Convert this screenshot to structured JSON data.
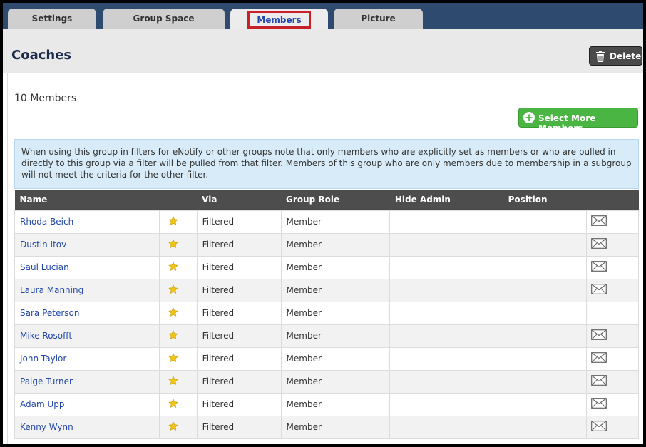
{
  "tabs": [
    {
      "label": "Settings"
    },
    {
      "label": "Group Space"
    },
    {
      "label": "Members"
    },
    {
      "label": "Picture"
    }
  ],
  "header": {
    "title": "Coaches",
    "delete_label": "Delete"
  },
  "members_count": "10 Members",
  "select_more_label": "Select More Members",
  "notice": "When using this group in filters for eNotify or other groups note that only members who are explicitly set as members or who are pulled in directly to this group via a filter will be pulled from that filter. Members of this group who are only members due to membership in a subgroup will not meet the criteria for the other filter.",
  "table": {
    "headers": [
      "Name",
      "",
      "Via",
      "Group Role",
      "Hide Admin",
      "Position",
      ""
    ],
    "rows": [
      {
        "name": "Rhoda Beich",
        "via": "Filtered",
        "role": "Member",
        "mail": true
      },
      {
        "name": "Dustin Itov",
        "via": "Filtered",
        "role": "Member",
        "mail": true
      },
      {
        "name": "Saul Lucian",
        "via": "Filtered",
        "role": "Member",
        "mail": true
      },
      {
        "name": "Laura Manning",
        "via": "Filtered",
        "role": "Member",
        "mail": true
      },
      {
        "name": "Sara Peterson",
        "via": "Filtered",
        "role": "Member",
        "mail": false
      },
      {
        "name": "Mike Rosofft",
        "via": "Filtered",
        "role": "Member",
        "mail": true
      },
      {
        "name": "John Taylor",
        "via": "Filtered",
        "role": "Member",
        "mail": true
      },
      {
        "name": "Paige Turner",
        "via": "Filtered",
        "role": "Member",
        "mail": true
      },
      {
        "name": "Adam Upp",
        "via": "Filtered",
        "role": "Member",
        "mail": true
      },
      {
        "name": "Kenny Wynn",
        "via": "Filtered",
        "role": "Member",
        "mail": true
      }
    ]
  },
  "colors": {
    "active_tab_outline": "#c8202a",
    "link": "#2347a8",
    "tabbar": "#2f4a6f",
    "add_button": "#4bb543"
  }
}
